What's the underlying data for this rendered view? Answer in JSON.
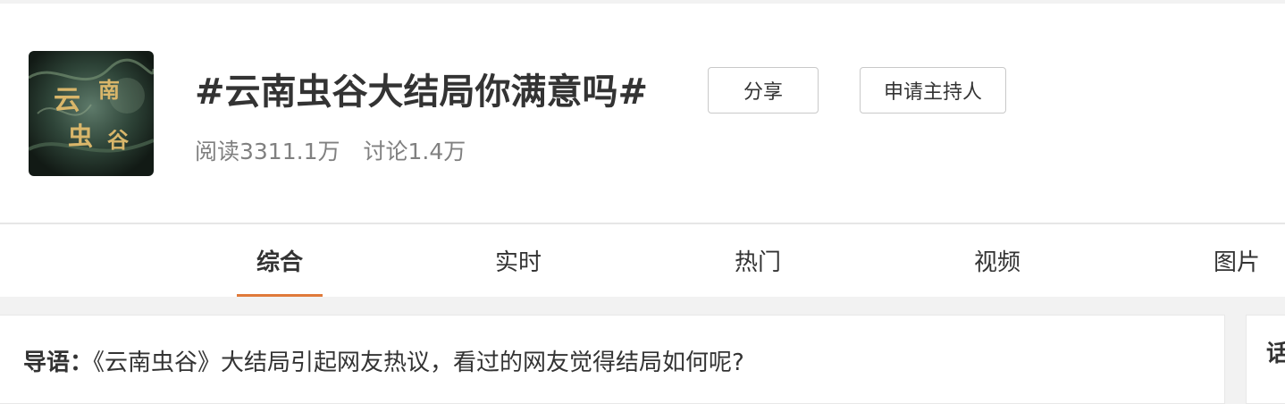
{
  "topic": {
    "title": "#云南虫谷大结局你满意吗#",
    "cover_icon": "drama-poster-image",
    "cover_text": "云南虫谷",
    "read_count": "阅读3311.1万",
    "discuss_count": "讨论1.4万",
    "share_label": "分享",
    "host_label": "申请主持人"
  },
  "tabs": [
    {
      "label": "综合",
      "active": true
    },
    {
      "label": "实时",
      "active": false
    },
    {
      "label": "热门",
      "active": false
    },
    {
      "label": "视频",
      "active": false
    },
    {
      "label": "图片",
      "active": false
    }
  ],
  "intro": {
    "prefix": "导语：",
    "text": "《云南虫谷》大结局引起网友热议，看过的网友觉得结局如何呢?"
  },
  "sidebar": {
    "title_partial": "话"
  },
  "colors": {
    "accent": "#e07a3a",
    "text": "#333333",
    "muted": "#808080",
    "background": "#f2f2f2"
  }
}
